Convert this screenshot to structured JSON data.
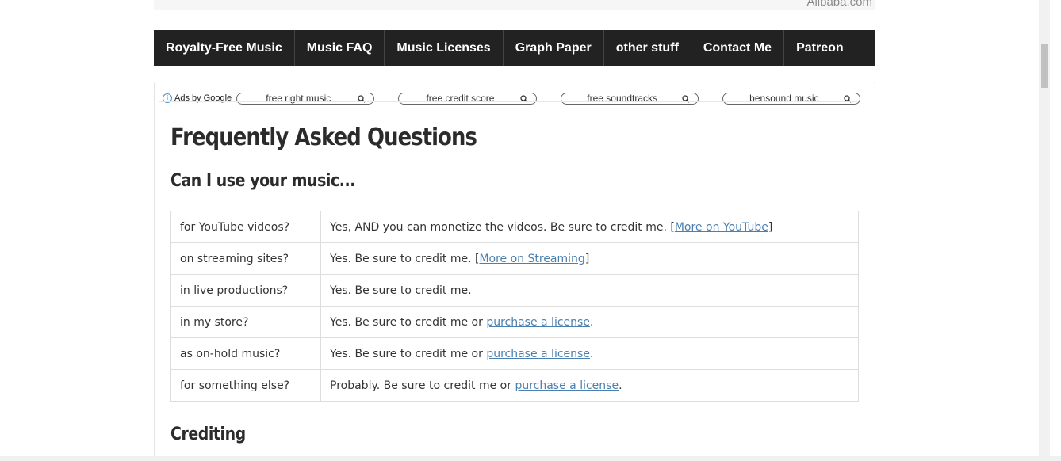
{
  "top_ad": {
    "text": "Alibaba.com"
  },
  "nav": {
    "items": [
      "Royalty-Free Music",
      "Music FAQ",
      "Music Licenses",
      "Graph Paper",
      "other stuff",
      "Contact Me",
      "Patreon"
    ]
  },
  "ads": {
    "label": "Ads by Google",
    "links": [
      "free right music",
      "free credit score",
      "free soundtracks",
      "bensound music"
    ]
  },
  "page": {
    "title": "Frequently Asked Questions",
    "subtitle": "Can I use your music...",
    "crediting": "Crediting"
  },
  "faq": {
    "rows": [
      {
        "q": "for YouTube videos?",
        "a_pre": "Yes, AND you can monetize the videos. Be sure to credit me. [",
        "link": "More on YouTube",
        "a_post": "]"
      },
      {
        "q": "on streaming sites?",
        "a_pre": "Yes. Be sure to credit me. [",
        "link": "More on Streaming",
        "a_post": "]"
      },
      {
        "q": "in live productions?",
        "a_pre": "Yes. Be sure to credit me.",
        "link": "",
        "a_post": ""
      },
      {
        "q": "in my store?",
        "a_pre": "Yes. Be sure to credit me or ",
        "link": "purchase a license",
        "a_post": "."
      },
      {
        "q": "as on-hold music?",
        "a_pre": "Yes. Be sure to credit me or ",
        "link": "purchase a license",
        "a_post": "."
      },
      {
        "q": "for something else?",
        "a_pre": "Probably. Be sure to credit me or ",
        "link": "purchase a license",
        "a_post": "."
      }
    ]
  },
  "colors": {
    "nav_bg": "#222222",
    "link": "#4a7fb0",
    "heading": "#2b2b2b"
  }
}
